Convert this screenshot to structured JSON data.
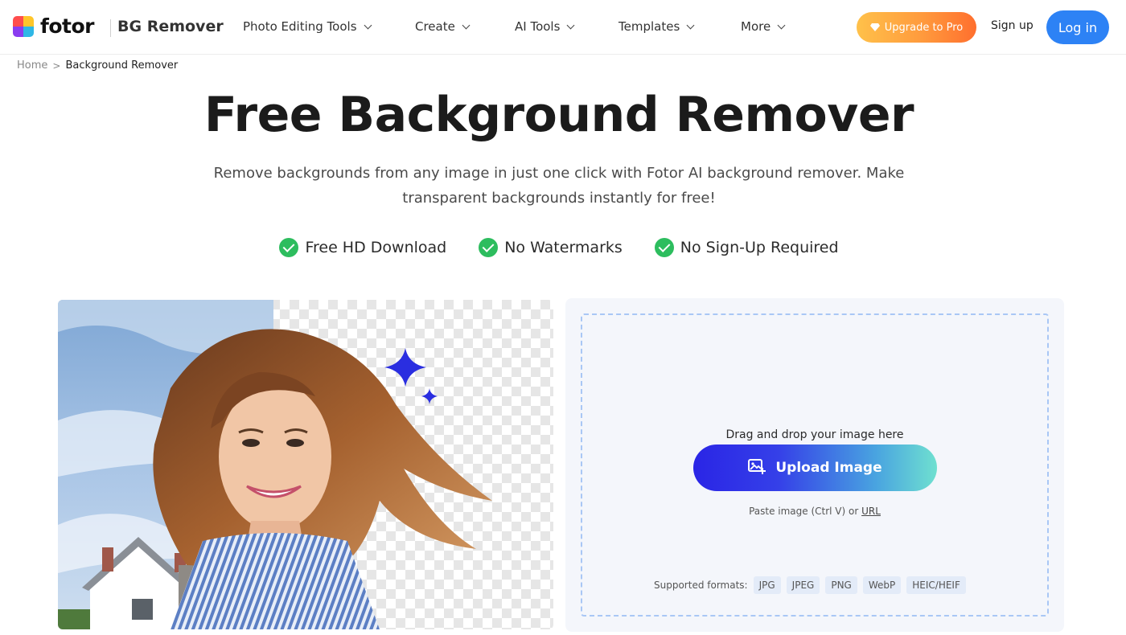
{
  "header": {
    "logo_text": "fotor",
    "product_name": "BG Remover",
    "nav": [
      {
        "label": "Photo Editing Tools"
      },
      {
        "label": "Create"
      },
      {
        "label": "AI Tools"
      },
      {
        "label": "Templates"
      },
      {
        "label": "More"
      }
    ],
    "upgrade_label": "Upgrade to Pro",
    "signup_label": "Sign up",
    "login_label": "Log in"
  },
  "breadcrumb": {
    "home": "Home",
    "separator": ">",
    "current": "Background Remover"
  },
  "hero": {
    "title": "Free Background Remover",
    "subtitle": "Remove backgrounds from any image in just one click with Fotor AI background remover. Make transparent backgrounds instantly for free!",
    "features": [
      {
        "label": "Free HD Download"
      },
      {
        "label": "No Watermarks"
      },
      {
        "label": "No Sign-Up Required"
      }
    ]
  },
  "upload": {
    "drop_text": "Drag and drop your image here",
    "button_label": "Upload Image",
    "paste_text": "Paste image (Ctrl V) or",
    "url_label": "URL",
    "formats_label": "Supported formats:",
    "formats": [
      "JPG",
      "JPEG",
      "PNG",
      "WebP",
      "HEIC/HEIF"
    ]
  },
  "colors": {
    "login_blue": "#2d82f5",
    "upgrade_orange": "#ff9a3d",
    "check_green": "#2dbd5e",
    "upload_gradient_start": "#2a25e6",
    "upload_gradient_end": "#6fe0d0"
  }
}
